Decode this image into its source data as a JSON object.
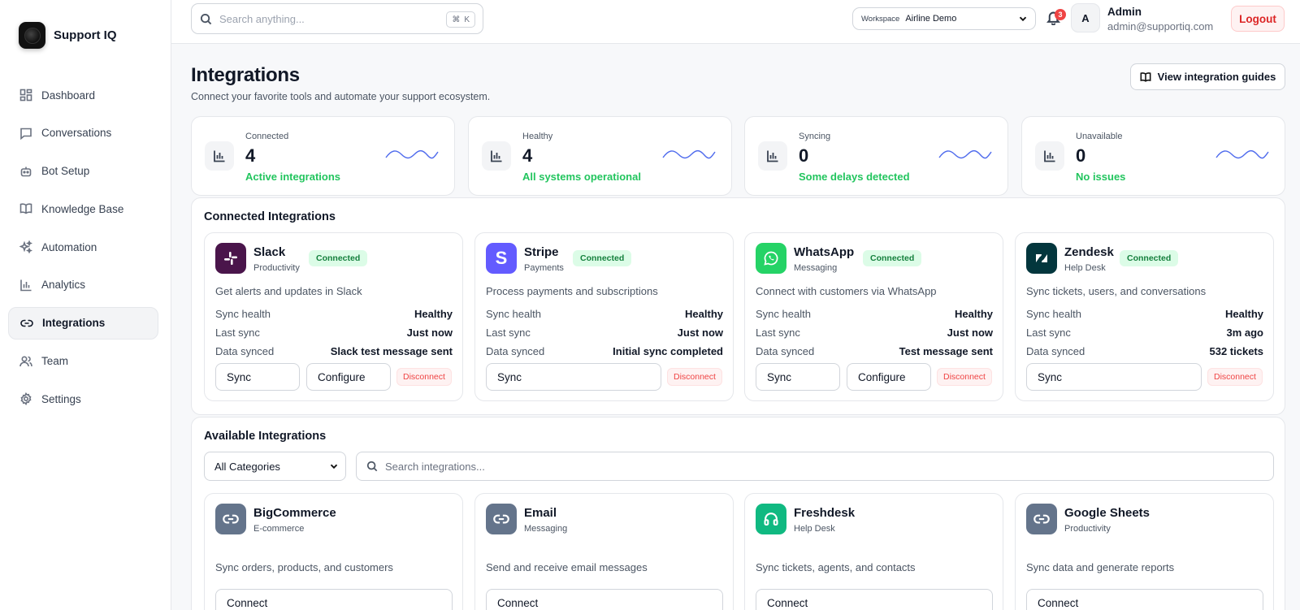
{
  "brand": {
    "name": "Support IQ"
  },
  "nav": [
    {
      "label": "Dashboard",
      "icon": "dashboard-icon"
    },
    {
      "label": "Conversations",
      "icon": "chat-icon"
    },
    {
      "label": "Bot Setup",
      "icon": "bot-icon"
    },
    {
      "label": "Knowledge Base",
      "icon": "book-icon"
    },
    {
      "label": "Automation",
      "icon": "sparkles-icon"
    },
    {
      "label": "Analytics",
      "icon": "bar-chart-icon"
    },
    {
      "label": "Integrations",
      "icon": "link-icon",
      "active": true
    },
    {
      "label": "Team",
      "icon": "users-icon"
    },
    {
      "label": "Settings",
      "icon": "gear-icon"
    }
  ],
  "topbar": {
    "search_placeholder": "Search anything...",
    "shortcut_symbol": "⌘",
    "shortcut_key": "K",
    "workspace_label": "Workspace",
    "workspace_value": "Airline Demo",
    "notifications_count": "3",
    "avatar_initial": "A",
    "user_name": "Admin",
    "user_email": "admin@supportiq.com",
    "logout_label": "Logout"
  },
  "page": {
    "title": "Integrations",
    "subtitle": "Connect your favorite tools and automate your support ecosystem.",
    "guides_label": "View integration guides"
  },
  "stats": [
    {
      "label": "Connected",
      "value": "4",
      "status": "Active integrations"
    },
    {
      "label": "Healthy",
      "value": "4",
      "status": "All systems operational"
    },
    {
      "label": "Syncing",
      "value": "0",
      "status": "Some delays detected"
    },
    {
      "label": "Unavailable",
      "value": "0",
      "status": "No issues"
    }
  ],
  "connected": {
    "title": "Connected Integrations",
    "row_labels": {
      "health": "Sync health",
      "last": "Last sync",
      "data": "Data synced"
    },
    "badge": "Connected",
    "sync_label": "Sync",
    "configure_label": "Configure",
    "disconnect_label": "Disconnect",
    "items": [
      {
        "name": "Slack",
        "category": "Productivity",
        "description": "Get alerts and updates in Slack",
        "health": "Healthy",
        "last_sync": "Just now",
        "data_synced": "Slack test message sent",
        "color": "#4a154b",
        "icon": "slack-icon"
      },
      {
        "name": "Stripe",
        "category": "Payments",
        "description": "Process payments and subscriptions",
        "health": "Healthy",
        "last_sync": "Just now",
        "data_synced": "Initial sync completed",
        "color": "#635bff",
        "icon": "stripe-icon"
      },
      {
        "name": "WhatsApp",
        "category": "Messaging",
        "description": "Connect with customers via WhatsApp",
        "health": "Healthy",
        "last_sync": "Just now",
        "data_synced": "Test message sent",
        "color": "#25d366",
        "icon": "whatsapp-icon"
      },
      {
        "name": "Zendesk",
        "category": "Help Desk",
        "description": "Sync tickets, users, and conversations",
        "health": "Healthy",
        "last_sync": "3m ago",
        "data_synced": "532 tickets",
        "color": "#03363d",
        "icon": "zendesk-icon"
      }
    ]
  },
  "available": {
    "title": "Available Integrations",
    "category_filter": "All Categories",
    "search_placeholder": "Search integrations...",
    "connect_label": "Connect",
    "items": [
      {
        "name": "BigCommerce",
        "category": "E-commerce",
        "description": "Sync orders, products, and customers",
        "color": "#64748b",
        "icon": "link-icon"
      },
      {
        "name": "Email",
        "category": "Messaging",
        "description": "Send and receive email messages",
        "color": "#64748b",
        "icon": "link-icon"
      },
      {
        "name": "Freshdesk",
        "category": "Help Desk",
        "description": "Sync tickets, agents, and contacts",
        "color": "#10b981",
        "icon": "headset-icon"
      },
      {
        "name": "Google Sheets",
        "category": "Productivity",
        "description": "Sync data and generate reports",
        "color": "#64748b",
        "icon": "link-icon"
      }
    ]
  },
  "colors": {
    "accent_green": "#22c55e",
    "danger": "#ef4444",
    "spark": "#4f6bed"
  }
}
